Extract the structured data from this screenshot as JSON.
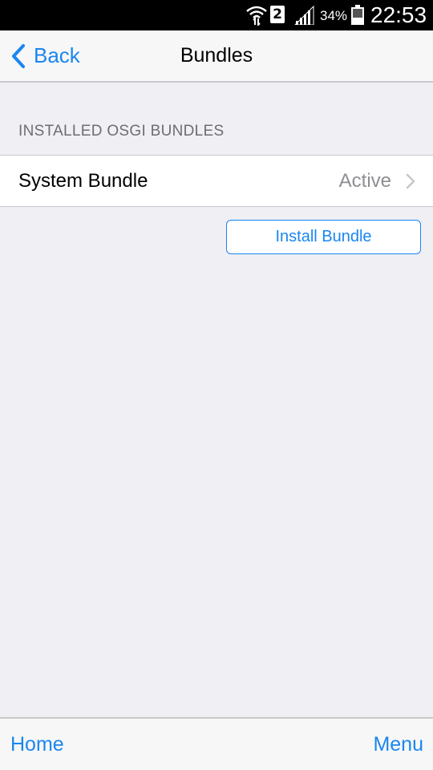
{
  "status_bar": {
    "sim_slot": "2",
    "battery_percent": "34%",
    "time": "22:53",
    "icons": [
      "wifi-icon",
      "sim-icon",
      "signal-icon",
      "battery-icon"
    ]
  },
  "nav": {
    "back_label": "Back",
    "title": "Bundles"
  },
  "section": {
    "header": "INSTALLED OSGI BUNDLES"
  },
  "bundles": [
    {
      "name": "System Bundle",
      "status": "Active"
    }
  ],
  "actions": {
    "install_label": "Install Bundle"
  },
  "toolbar": {
    "home_label": "Home",
    "menu_label": "Menu"
  },
  "colors": {
    "accent": "#1a86f0",
    "background": "#efeff4",
    "status_text": "#8e8e93",
    "section_text": "#6d6d72"
  }
}
